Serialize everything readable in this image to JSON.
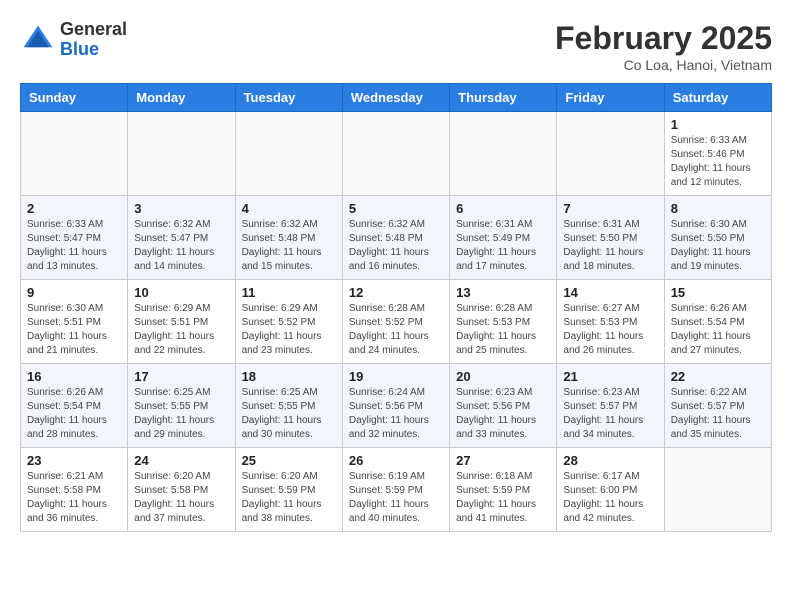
{
  "header": {
    "logo_general": "General",
    "logo_blue": "Blue",
    "month": "February 2025",
    "location": "Co Loa, Hanoi, Vietnam"
  },
  "days_of_week": [
    "Sunday",
    "Monday",
    "Tuesday",
    "Wednesday",
    "Thursday",
    "Friday",
    "Saturday"
  ],
  "weeks": [
    [
      {
        "day": "",
        "info": ""
      },
      {
        "day": "",
        "info": ""
      },
      {
        "day": "",
        "info": ""
      },
      {
        "day": "",
        "info": ""
      },
      {
        "day": "",
        "info": ""
      },
      {
        "day": "",
        "info": ""
      },
      {
        "day": "1",
        "info": "Sunrise: 6:33 AM\nSunset: 5:46 PM\nDaylight: 11 hours and 12 minutes."
      }
    ],
    [
      {
        "day": "2",
        "info": "Sunrise: 6:33 AM\nSunset: 5:47 PM\nDaylight: 11 hours and 13 minutes."
      },
      {
        "day": "3",
        "info": "Sunrise: 6:32 AM\nSunset: 5:47 PM\nDaylight: 11 hours and 14 minutes."
      },
      {
        "day": "4",
        "info": "Sunrise: 6:32 AM\nSunset: 5:48 PM\nDaylight: 11 hours and 15 minutes."
      },
      {
        "day": "5",
        "info": "Sunrise: 6:32 AM\nSunset: 5:48 PM\nDaylight: 11 hours and 16 minutes."
      },
      {
        "day": "6",
        "info": "Sunrise: 6:31 AM\nSunset: 5:49 PM\nDaylight: 11 hours and 17 minutes."
      },
      {
        "day": "7",
        "info": "Sunrise: 6:31 AM\nSunset: 5:50 PM\nDaylight: 11 hours and 18 minutes."
      },
      {
        "day": "8",
        "info": "Sunrise: 6:30 AM\nSunset: 5:50 PM\nDaylight: 11 hours and 19 minutes."
      }
    ],
    [
      {
        "day": "9",
        "info": "Sunrise: 6:30 AM\nSunset: 5:51 PM\nDaylight: 11 hours and 21 minutes."
      },
      {
        "day": "10",
        "info": "Sunrise: 6:29 AM\nSunset: 5:51 PM\nDaylight: 11 hours and 22 minutes."
      },
      {
        "day": "11",
        "info": "Sunrise: 6:29 AM\nSunset: 5:52 PM\nDaylight: 11 hours and 23 minutes."
      },
      {
        "day": "12",
        "info": "Sunrise: 6:28 AM\nSunset: 5:52 PM\nDaylight: 11 hours and 24 minutes."
      },
      {
        "day": "13",
        "info": "Sunrise: 6:28 AM\nSunset: 5:53 PM\nDaylight: 11 hours and 25 minutes."
      },
      {
        "day": "14",
        "info": "Sunrise: 6:27 AM\nSunset: 5:53 PM\nDaylight: 11 hours and 26 minutes."
      },
      {
        "day": "15",
        "info": "Sunrise: 6:26 AM\nSunset: 5:54 PM\nDaylight: 11 hours and 27 minutes."
      }
    ],
    [
      {
        "day": "16",
        "info": "Sunrise: 6:26 AM\nSunset: 5:54 PM\nDaylight: 11 hours and 28 minutes."
      },
      {
        "day": "17",
        "info": "Sunrise: 6:25 AM\nSunset: 5:55 PM\nDaylight: 11 hours and 29 minutes."
      },
      {
        "day": "18",
        "info": "Sunrise: 6:25 AM\nSunset: 5:55 PM\nDaylight: 11 hours and 30 minutes."
      },
      {
        "day": "19",
        "info": "Sunrise: 6:24 AM\nSunset: 5:56 PM\nDaylight: 11 hours and 32 minutes."
      },
      {
        "day": "20",
        "info": "Sunrise: 6:23 AM\nSunset: 5:56 PM\nDaylight: 11 hours and 33 minutes."
      },
      {
        "day": "21",
        "info": "Sunrise: 6:23 AM\nSunset: 5:57 PM\nDaylight: 11 hours and 34 minutes."
      },
      {
        "day": "22",
        "info": "Sunrise: 6:22 AM\nSunset: 5:57 PM\nDaylight: 11 hours and 35 minutes."
      }
    ],
    [
      {
        "day": "23",
        "info": "Sunrise: 6:21 AM\nSunset: 5:58 PM\nDaylight: 11 hours and 36 minutes."
      },
      {
        "day": "24",
        "info": "Sunrise: 6:20 AM\nSunset: 5:58 PM\nDaylight: 11 hours and 37 minutes."
      },
      {
        "day": "25",
        "info": "Sunrise: 6:20 AM\nSunset: 5:59 PM\nDaylight: 11 hours and 38 minutes."
      },
      {
        "day": "26",
        "info": "Sunrise: 6:19 AM\nSunset: 5:59 PM\nDaylight: 11 hours and 40 minutes."
      },
      {
        "day": "27",
        "info": "Sunrise: 6:18 AM\nSunset: 5:59 PM\nDaylight: 11 hours and 41 minutes."
      },
      {
        "day": "28",
        "info": "Sunrise: 6:17 AM\nSunset: 6:00 PM\nDaylight: 11 hours and 42 minutes."
      },
      {
        "day": "",
        "info": ""
      }
    ]
  ]
}
